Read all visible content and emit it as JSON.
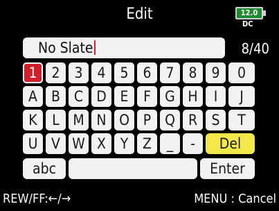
{
  "header": {
    "title": "Edit"
  },
  "battery": {
    "value": "12.0",
    "source": "DC"
  },
  "input": {
    "value": "No Slate",
    "counter": "8/40"
  },
  "keyboard": {
    "row1": [
      "1",
      "2",
      "3",
      "4",
      "5",
      "6",
      "7",
      "8",
      "9",
      "0"
    ],
    "row2": [
      "A",
      "B",
      "C",
      "D",
      "E",
      "F",
      "G",
      "H",
      "I",
      "J"
    ],
    "row3": [
      "K",
      "L",
      "M",
      "N",
      "O",
      "P",
      "Q",
      "R",
      "S",
      "T"
    ],
    "row4": [
      "U",
      "V",
      "W",
      "X",
      "Y",
      "Z",
      "_",
      "-"
    ],
    "del": "Del",
    "mode": "abc",
    "space": "",
    "enter": "Enter",
    "selected": "1",
    "colors": {
      "selected": "#d21e28",
      "del": "#f3e84a",
      "battery": "#1f8a32"
    }
  },
  "footer": {
    "left": "REW/FF:←/→",
    "right": "MENU : Cancel"
  }
}
